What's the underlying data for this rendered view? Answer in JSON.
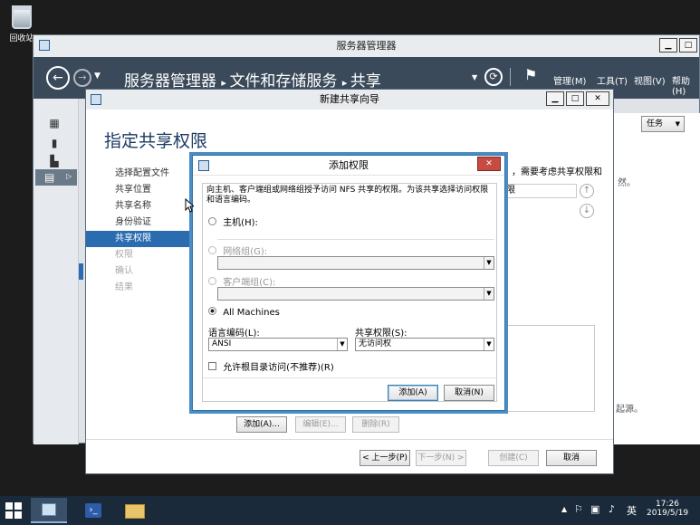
{
  "desktop": {
    "recycle_bin": "回收站"
  },
  "server_manager": {
    "title": "服务器管理器",
    "breadcrumb": [
      "服务器管理器",
      "文件和存储服务",
      "共享"
    ],
    "menu": [
      "管理(M)",
      "工具(T)",
      "视图(V)",
      "帮助(H)"
    ],
    "tasks_label": "任务",
    "right_text_1": "然。",
    "right_text_2": "起源。"
  },
  "wizard": {
    "title": "新建共享向导",
    "heading": "指定共享权限",
    "steps": [
      {
        "label": "选择配置文件",
        "state": "done"
      },
      {
        "label": "共享位置",
        "state": "done"
      },
      {
        "label": "共享名称",
        "state": "done"
      },
      {
        "label": "身份验证",
        "state": "done"
      },
      {
        "label": "共享权限",
        "state": "current"
      },
      {
        "label": "权限",
        "state": "disabled"
      },
      {
        "label": "确认",
        "state": "disabled"
      },
      {
        "label": "结果",
        "state": "disabled"
      }
    ],
    "info_text": "，需要考虑共享权限和",
    "list_fragment": "限",
    "buttons": {
      "add": "添加(A)...",
      "edit": "编辑(E)...",
      "remove": "删除(R)"
    },
    "footer": {
      "prev": "< 上一步(P)",
      "next": "下一步(N) >",
      "create": "创建(C)",
      "cancel": "取消"
    }
  },
  "dialog": {
    "title": "添加权限",
    "description": "向主机、客户端组或网络组授予访问 NFS 共享的权限。为该共享选择访问权限和语言编码。",
    "host_label": "主机(H):",
    "netgroup_label": "网络组(G):",
    "client_group_label": "客户端组(C):",
    "all_machines_label": "All Machines",
    "selected_option": "All Machines",
    "encoding_label": "语言编码(L):",
    "encoding_value": "ANSI",
    "permission_label": "共享权限(S):",
    "permission_value": "无访问权",
    "allow_root_label": "允许根目录访问(不推荐)(R)",
    "add_button": "添加(A)",
    "cancel_button": "取消(N)"
  },
  "taskbar": {
    "time": "17:26",
    "date": "2019/5/19",
    "ime": "英"
  }
}
